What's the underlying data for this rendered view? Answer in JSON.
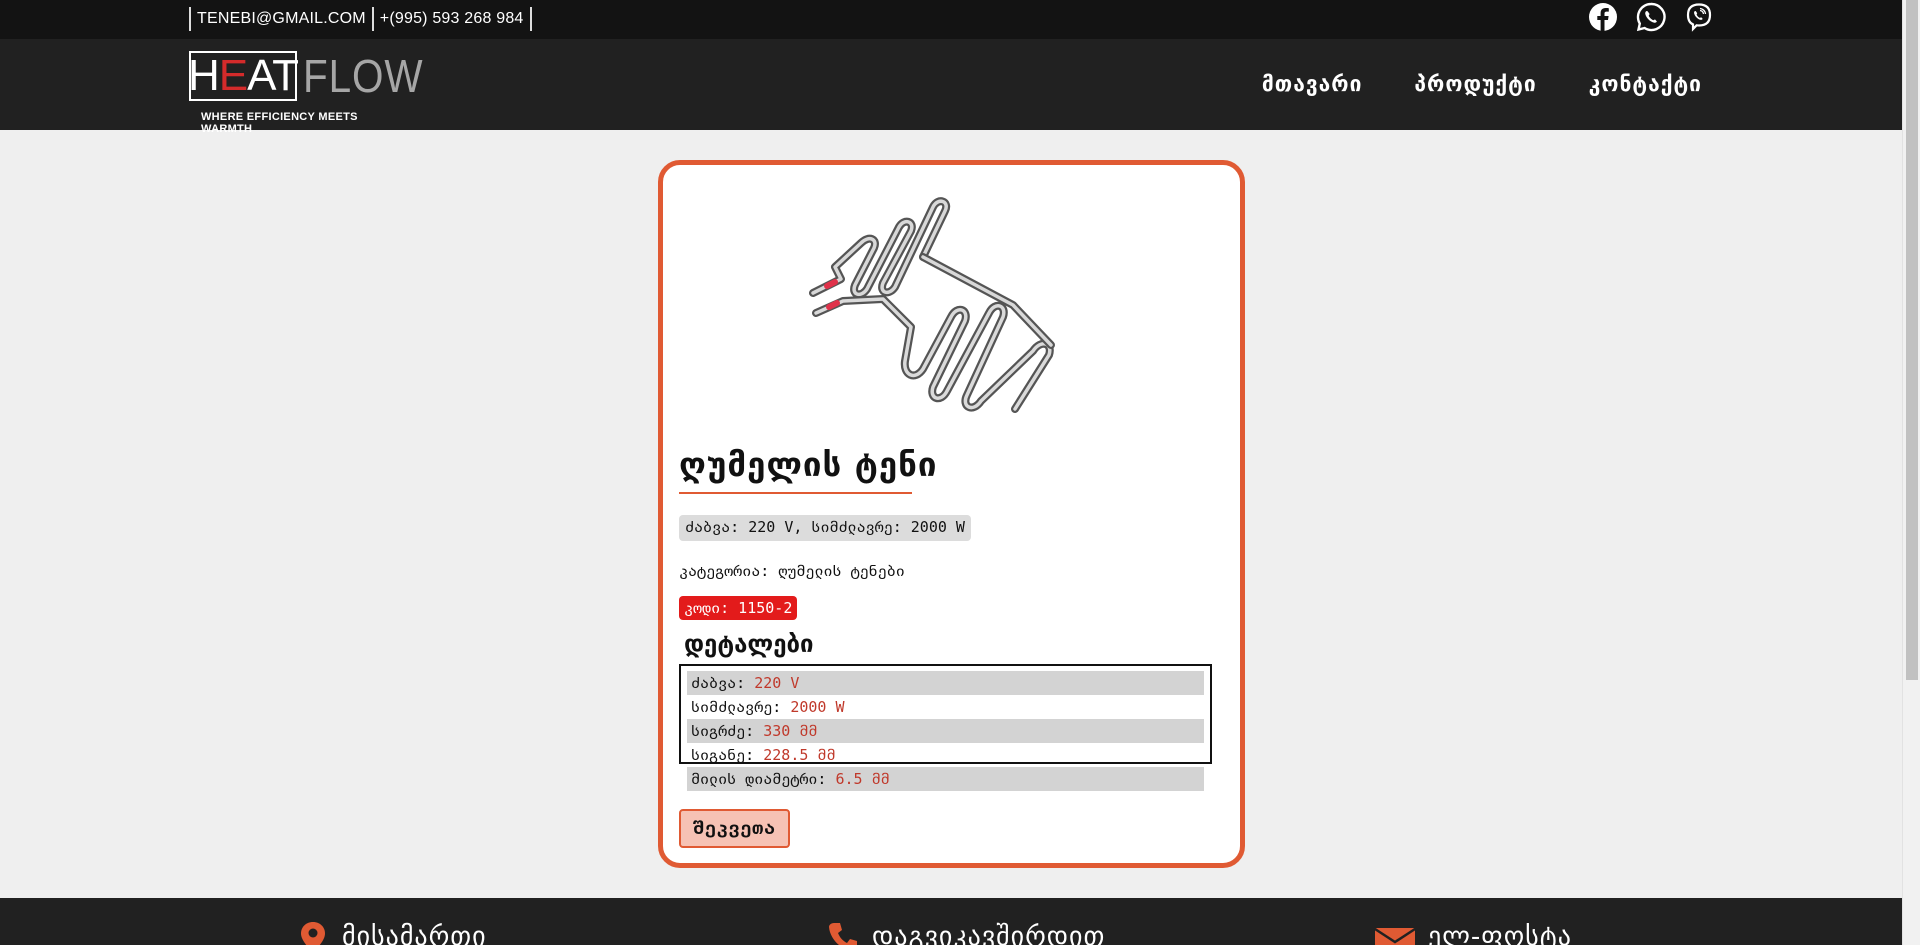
{
  "topbar": {
    "email": "TENEBI@GMAIL.COM",
    "phone": "+(995) 593 268 984",
    "socials": [
      "facebook-icon",
      "whatsapp-icon",
      "viber-icon"
    ]
  },
  "brand": {
    "logo_left_1": "H",
    "logo_left_mid": "E",
    "logo_left_2": "AT",
    "logo_right": "FLOW",
    "tagline": "WHERE EFFICIENCY MEETS WARMTH",
    "accent": "#e05a33",
    "logo_red": "#d42b2b"
  },
  "nav": {
    "items": [
      "მთავარი",
      "პროდუქტი",
      "კონტაქტი"
    ]
  },
  "product": {
    "title": "ღუმელის ტენი",
    "spec_summary": "ძაბვა: 220 V, სიმძლავრე: 2000 W",
    "category": "კატეგორია: ღუმელის ტენები",
    "code": "კოდი: 1150-2",
    "details_title": "დეტალები",
    "details": [
      {
        "label": "ძაბვა: ",
        "value": "220 V"
      },
      {
        "label": "სიმძლავრე: ",
        "value": "2000 W"
      },
      {
        "label": "სიგრძე: ",
        "value": "330 მმ"
      },
      {
        "label": "სიგანე: ",
        "value": "228.5 მმ"
      },
      {
        "label": "მილის დიამეტრი: ",
        "value": "6.5 მმ"
      }
    ],
    "order_label": "შეკვეთა"
  },
  "footer": {
    "address_label": "მისამართი",
    "contact_label": "დაგვიკავშირდით",
    "email_label": "ელ-ფოსტა"
  }
}
